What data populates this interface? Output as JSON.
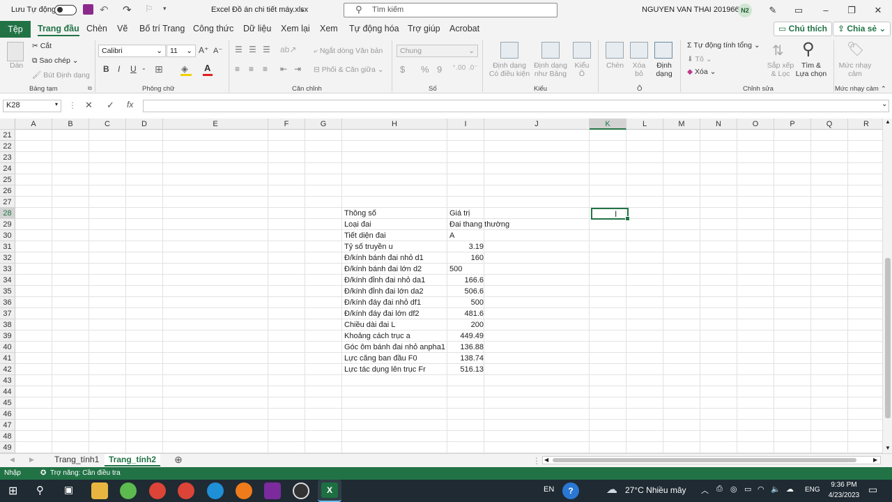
{
  "titlebar": {
    "autosave_label": "Lưu Tự động",
    "file_name": "Excel Đồ án chi tiết máy.xlsx",
    "search_placeholder": "Tìm kiếm",
    "user_name": "NGUYEN VAN THAI 20196684",
    "user_initials": "N2"
  },
  "tabs": [
    "Tệp",
    "Trang đầu",
    "Chèn",
    "Vẽ",
    "Bố trí Trang",
    "Công thức",
    "Dữ liệu",
    "Xem lại",
    "Xem",
    "Tự động hóa",
    "Trợ giúp",
    "Acrobat"
  ],
  "tab_actions": {
    "comments": "Chú thích",
    "share": "Chia sẻ"
  },
  "ribbon": {
    "clipboard": {
      "paste": "Dán",
      "cut": "Cắt",
      "copy": "Sao chép",
      "format_painter": "Bút Định dạng",
      "group": "Bảng tạm"
    },
    "font": {
      "name": "Calibri",
      "size": "11",
      "bold": "B",
      "italic": "I",
      "underline": "U",
      "group": "Phông chữ"
    },
    "alignment": {
      "wrap": "Ngắt dòng Văn bản",
      "merge": "Phối & Căn giữa",
      "group": "Căn chỉnh"
    },
    "number": {
      "format": "Chung",
      "currency": "$",
      "percent": "%",
      "comma": "9",
      "group": "Số"
    },
    "styles": {
      "conditional": "Định dạng Có điều kiện",
      "as_table": "Định dạng như Bảng",
      "cell_styles": "Kiểu Ô",
      "group": "Kiểu"
    },
    "cells": {
      "insert": "Chèn",
      "delete": "Xóa bỏ",
      "format": "Định dạng",
      "group": "Ô"
    },
    "editing": {
      "autosum": "Tự động tính tổng",
      "fill": "Tô",
      "clear": "Xóa",
      "sort": "Sắp xếp & Lọc",
      "find": "Tìm & Lựa chọn",
      "group": "Chỉnh sửa"
    },
    "sensitivity": {
      "label": "Mức nhạy cảm",
      "group": "Mức nhạy cảm"
    }
  },
  "formula_bar": {
    "name_box": "K28",
    "fx": "fx",
    "content": ""
  },
  "columns": [
    "A",
    "B",
    "C",
    "D",
    "E",
    "F",
    "G",
    "H",
    "I",
    "J",
    "K",
    "L",
    "M",
    "N",
    "O",
    "P",
    "Q",
    "R"
  ],
  "rows": [
    "21",
    "22",
    "23",
    "24",
    "25",
    "26",
    "27",
    "28",
    "29",
    "30",
    "31",
    "32",
    "33",
    "34",
    "35",
    "36",
    "37",
    "38",
    "39",
    "40",
    "41",
    "42",
    "43",
    "44",
    "45",
    "46",
    "47",
    "48",
    "49"
  ],
  "selected_cell": "K28",
  "table": [
    {
      "row": "28",
      "param": "Thông số",
      "value": "Giá trị",
      "align": "left"
    },
    {
      "row": "29",
      "param": "Loại đai",
      "value": "Đai thang thường",
      "align": "left"
    },
    {
      "row": "30",
      "param": "Tiết diện đai",
      "value": "A",
      "align": "left"
    },
    {
      "row": "31",
      "param": "Tỷ số truyền u",
      "value": "3.19",
      "align": "right"
    },
    {
      "row": "32",
      "param": "Đ/kính bánh đai nhỏ d1",
      "value": "160",
      "align": "right"
    },
    {
      "row": "33",
      "param": "Đ/kính bánh đai lớn d2",
      "value": "500",
      "align": "left"
    },
    {
      "row": "34",
      "param": "Đ/kính đỉnh đai nhỏ da1",
      "value": "166.6",
      "align": "right"
    },
    {
      "row": "35",
      "param": "Đ/kính đỉnh đai lớn da2",
      "value": "506.6",
      "align": "right"
    },
    {
      "row": "36",
      "param": "Đ/kính đáy đai nhỏ df1",
      "value": "500",
      "align": "right"
    },
    {
      "row": "37",
      "param": "Đ/kính đáy đai lớn df2",
      "value": "481.6",
      "align": "right"
    },
    {
      "row": "38",
      "param": "Chiều dài đai L",
      "value": "200",
      "align": "right"
    },
    {
      "row": "39",
      "param": "Khoảng cách trục a",
      "value": "449.49",
      "align": "right"
    },
    {
      "row": "40",
      "param": "Góc ôm bánh đai nhỏ anpha1",
      "value": "136.88",
      "align": "right"
    },
    {
      "row": "41",
      "param": "Lực căng ban đầu F0",
      "value": "138.74",
      "align": "right"
    },
    {
      "row": "42",
      "param": "Lực tác dụng lên trục Fr",
      "value": "516.13",
      "align": "right"
    }
  ],
  "sheets": [
    "Trang_tính1",
    "Trang_tính2"
  ],
  "active_sheet": "Trang_tính2",
  "status": {
    "mode": "Nhập",
    "accessibility": "Trợ năng: Cần điều tra"
  },
  "taskbar": {
    "lang1": "EN",
    "weather": "27°C  Nhiều mây",
    "lang2": "ENG",
    "time": "9:36 PM",
    "date": "4/23/2023"
  },
  "colors": {
    "accent": "#217346",
    "taskbar": "#1f2a33"
  }
}
